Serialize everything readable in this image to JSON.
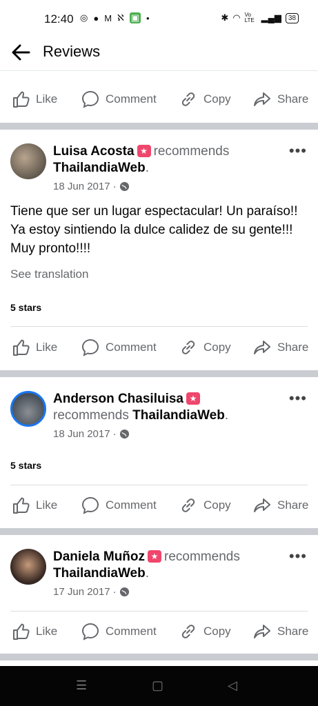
{
  "status": {
    "time": "12:40",
    "battery": "38",
    "left_icons": [
      "instagram-icon",
      "line-icon",
      "gmail-icon",
      "thai-icon",
      "android-app-icon",
      "dot-icon"
    ],
    "right_icons": [
      "bluetooth-icon",
      "wifi-icon",
      "volte-icon",
      "signal-icon"
    ],
    "volte_label": "Vo LTE"
  },
  "header": {
    "title": "Reviews",
    "back_icon": "arrow-left-icon"
  },
  "actions": {
    "like": "Like",
    "comment": "Comment",
    "copy": "Copy",
    "share": "Share"
  },
  "posts": [
    {
      "name": "Luisa Acosta",
      "recommends": "recommends",
      "page": "ThailandiaWeb",
      "date": "18 Jun 2017",
      "text": "Tiene que ser un lugar espectacular! Un paraíso!! Ya estoy sintiendo la dulce calidez de su gente!!! Muy pronto!!!!",
      "see_translation": "See translation",
      "rating": "5 stars"
    },
    {
      "name": "Anderson Chasiluisa",
      "recommends": "recommends",
      "page": "ThailandiaWeb",
      "date": "18 Jun 2017",
      "rating": "5 stars"
    },
    {
      "name": "Daniela Muñoz",
      "recommends": "recommends",
      "page": "ThailandiaWeb",
      "date": "17 Jun 2017"
    }
  ],
  "colors": {
    "separator": "#c9ccd1",
    "badge": "#f0466c",
    "muted": "#65676b"
  }
}
